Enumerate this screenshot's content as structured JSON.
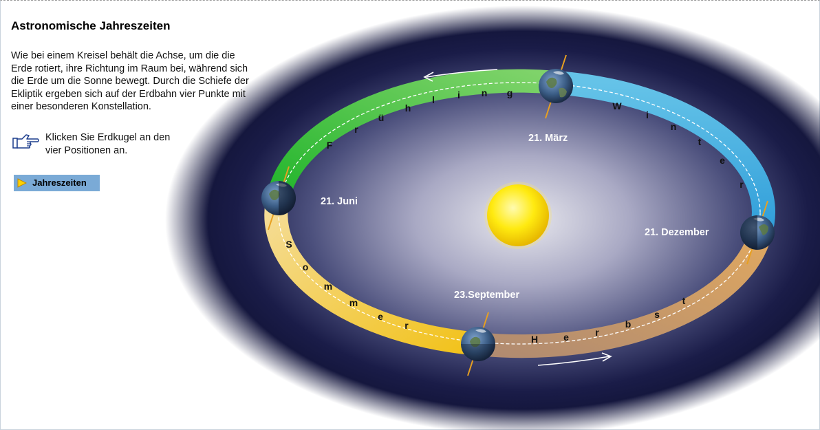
{
  "title": "Astronomische Jahreszeiten",
  "intro_lines": [
    "Wie bei einem Kreisel behält die Achse, um die die",
    "Erde rotiert, ihre Richtung im Raum bei, während sich",
    "die Erde um die Sonne bewegt. Durch die Schiefe der",
    "Ekliptik ergeben sich auf der Erdbahn vier Punkte mit",
    "einer besonderen Konstellation."
  ],
  "hint_lines": [
    "Klicken Sie Erdkugel an den",
    "vier Positionen an."
  ],
  "season_button_label": "Jahreszeiten",
  "positions": {
    "maerz": "21. März",
    "juni": "21. Juni",
    "september": "23.September",
    "dezember": "21. Dezember"
  },
  "seasons": {
    "fruehling": "Frühling",
    "winter": "Winter",
    "sommer": "Sommer",
    "herbst": "Herbst"
  },
  "colors": {
    "fruehling": "#2fbf3a",
    "winter": "#3aa8dc",
    "sommer": "#f0c030",
    "herbst": "#c09060",
    "sun": "#ffe100",
    "button": "#7aaad6",
    "axis": "#e8a020"
  },
  "icons": [
    "pointing-hand-icon",
    "play-triangle-icon",
    "sun-icon",
    "earth-icon",
    "orbit-arrow-icon"
  ]
}
